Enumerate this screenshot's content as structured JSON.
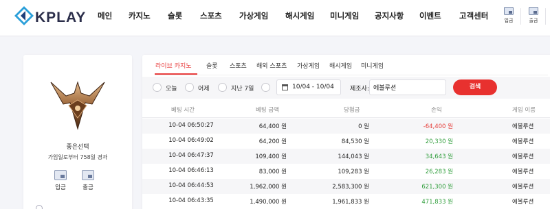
{
  "header": {
    "logo_text": "KPLAY",
    "nav": [
      "메인",
      "카지노",
      "슬롯",
      "스포츠",
      "가상게임",
      "해시게임",
      "미니게임",
      "공지사항",
      "이벤트",
      "고객센터"
    ],
    "deposit_label": "입금",
    "withdraw_label": "출금"
  },
  "profile": {
    "name": "좋은선택",
    "subtitle": "가입일로부터 758일 경과",
    "deposit_label": "입금",
    "withdraw_label": "출금"
  },
  "tabs": [
    "라이브 카지노",
    "슬롯",
    "스포츠",
    "해외 스포츠",
    "가상게임",
    "해시게임",
    "미니게임"
  ],
  "filter": {
    "options": [
      "오늘",
      "어제",
      "지난 7일"
    ],
    "date_range": "10/04 - 10/04",
    "game_label": "제조사:",
    "game_value": "에볼루션",
    "search_label": "검색"
  },
  "table": {
    "headers": [
      "베팅 시간",
      "베팅 금액",
      "당첨금",
      "손익",
      "게임 이름"
    ],
    "rows": [
      {
        "time": "10-04 06:50:27",
        "bet": "64,400 원",
        "win": "0 원",
        "pnl": "-64,400 원",
        "game": "에볼루션",
        "sign": "neg"
      },
      {
        "time": "10-04 06:49:02",
        "bet": "64,200 원",
        "win": "84,530 원",
        "pnl": "20,330 원",
        "game": "에볼루션",
        "sign": "pos"
      },
      {
        "time": "10-04 06:47:37",
        "bet": "109,400 원",
        "win": "144,043 원",
        "pnl": "34,643 원",
        "game": "에볼루션",
        "sign": "pos"
      },
      {
        "time": "10-04 06:46:13",
        "bet": "83,000 원",
        "win": "109,283 원",
        "pnl": "26,283 원",
        "game": "에볼루션",
        "sign": "pos"
      },
      {
        "time": "10-04 06:44:53",
        "bet": "1,962,000 원",
        "win": "2,583,300 원",
        "pnl": "621,300 원",
        "game": "에볼루션",
        "sign": "pos"
      },
      {
        "time": "10-04 06:43:35",
        "bet": "1,490,000 원",
        "win": "1,961,833 원",
        "pnl": "471,833 원",
        "game": "에볼루션",
        "sign": "pos"
      }
    ]
  },
  "colors": {
    "accent": "#e8312f",
    "negative": "#e53935",
    "positive": "#2e9d3a"
  }
}
